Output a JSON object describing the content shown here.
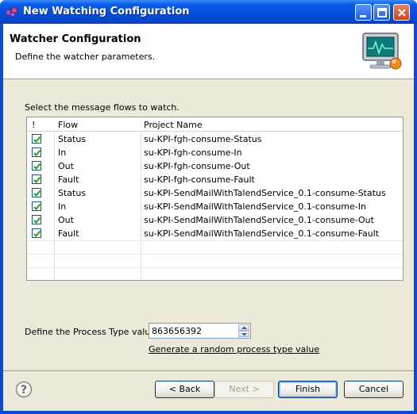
{
  "window": {
    "title": "New Watching Configuration"
  },
  "header": {
    "title": "Watcher Configuration",
    "description": "Define the watcher parameters."
  },
  "flows_section": {
    "label": "Select the message flows to watch.",
    "columns": [
      "!",
      "Flow",
      "Project Name"
    ],
    "rows": [
      {
        "checked": true,
        "flow": "Status",
        "project": "su-KPI-fgh-consume-Status"
      },
      {
        "checked": true,
        "flow": "In",
        "project": "su-KPI-fgh-consume-In"
      },
      {
        "checked": true,
        "flow": "Out",
        "project": "su-KPI-fgh-consume-Out"
      },
      {
        "checked": true,
        "flow": "Fault",
        "project": "su-KPI-fgh-consume-Fault"
      },
      {
        "checked": true,
        "flow": "Status",
        "project": "su-KPI-SendMailWithTalendService_0.1-consume-Status"
      },
      {
        "checked": true,
        "flow": "In",
        "project": "su-KPI-SendMailWithTalendService_0.1-consume-In"
      },
      {
        "checked": true,
        "flow": "Out",
        "project": "su-KPI-SendMailWithTalendService_0.1-consume-Out"
      },
      {
        "checked": true,
        "flow": "Fault",
        "project": "su-KPI-SendMailWithTalendService_0.1-consume-Fault"
      }
    ]
  },
  "process_type": {
    "label": "Define the Process Type value:",
    "value": "863656392",
    "generate_link": "Generate a random process type value"
  },
  "buttons": {
    "back": "< Back",
    "next": "Next >",
    "finish": "Finish",
    "cancel": "Cancel"
  },
  "colors": {
    "titlebar": "#0450de",
    "dialog_bg": "#ece9d8",
    "check": "#21a121"
  }
}
